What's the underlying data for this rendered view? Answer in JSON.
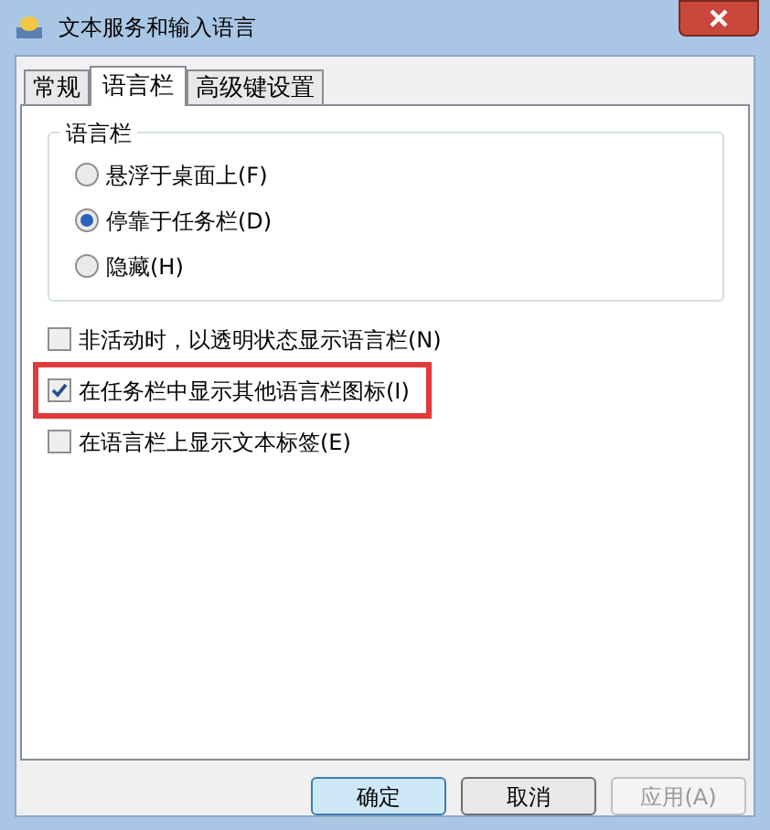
{
  "window": {
    "title": "文本服务和输入语言"
  },
  "tabs": [
    {
      "label": "常规",
      "selected": false
    },
    {
      "label": "语言栏",
      "selected": true
    },
    {
      "label": "高级键设置",
      "selected": false
    }
  ],
  "group": {
    "title": "语言栏",
    "options": [
      {
        "label": "悬浮于桌面上(F)",
        "selected": false
      },
      {
        "label": "停靠于任务栏(D)",
        "selected": true
      },
      {
        "label": "隐藏(H)",
        "selected": false
      }
    ]
  },
  "checkboxes": [
    {
      "label": "非活动时，以透明状态显示语言栏(N)",
      "checked": false,
      "highlighted": false
    },
    {
      "label": "在任务栏中显示其他语言栏图标(I)",
      "checked": true,
      "highlighted": true
    },
    {
      "label": "在语言栏上显示文本标签(E)",
      "checked": false,
      "highlighted": false
    }
  ],
  "buttons": [
    {
      "label": "确定",
      "kind": "default",
      "disabled": false
    },
    {
      "label": "取消",
      "kind": "normal",
      "disabled": false
    },
    {
      "label": "应用(A)",
      "kind": "normal",
      "disabled": true
    }
  ]
}
